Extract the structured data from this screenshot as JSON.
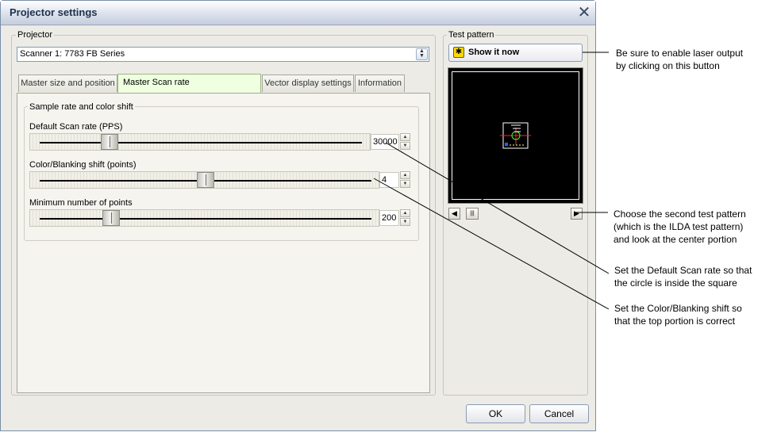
{
  "window": {
    "title": "Projector settings",
    "close_symbol": "✕"
  },
  "projector": {
    "label": "Projector",
    "selected": "Scanner 1: 7783 FB Series"
  },
  "tabs": [
    {
      "label": "Master size and position",
      "active": false
    },
    {
      "label": "Master Scan rate",
      "active": true
    },
    {
      "label": "Vector display settings",
      "active": false
    },
    {
      "label": "Information",
      "active": false
    }
  ],
  "sample_group": {
    "label": "Sample rate and color shift",
    "sliders": [
      {
        "label": "Default Scan rate (PPS)",
        "value": "30000",
        "position": 0.2
      },
      {
        "label": "Color/Blanking shift (points)",
        "value": "4",
        "position": 0.5
      },
      {
        "label": "Minimum number of points",
        "value": "200",
        "position": 0.2
      }
    ]
  },
  "test_pattern": {
    "label": "Test pattern",
    "show_button": "Show it now",
    "scroll_position": 0.05
  },
  "buttons": {
    "ok": "OK",
    "cancel": "Cancel"
  },
  "annotations": [
    {
      "lines": [
        "Be sure to enable laser output",
        "by clicking on this button"
      ]
    },
    {
      "lines": [
        "Choose the second test pattern",
        "(which is the ILDA test pattern)",
        "and look at the center portion"
      ]
    },
    {
      "lines": [
        "Set the Default Scan rate so that",
        "the circle is inside the square"
      ]
    },
    {
      "lines": [
        "Set the Color/Blanking shift so",
        "that the top portion is correct"
      ]
    }
  ],
  "colors": {
    "title_text": "#20324e",
    "active_tab": "#efffe0",
    "warning": "#ffd800"
  }
}
